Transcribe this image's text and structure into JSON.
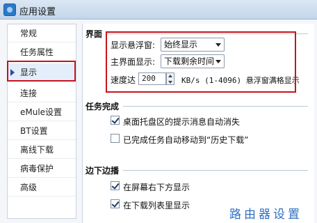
{
  "window": {
    "title": "应用设置"
  },
  "sidebar": {
    "items": [
      {
        "label": "常规"
      },
      {
        "label": "任务属性"
      },
      {
        "label": "显示"
      },
      {
        "label": "连接"
      },
      {
        "label": "eMule设置"
      },
      {
        "label": "BT设置"
      },
      {
        "label": "离线下载"
      },
      {
        "label": "病毒保护"
      },
      {
        "label": "高级"
      }
    ],
    "selected_index": 2
  },
  "sections": {
    "interface": {
      "title": "界面",
      "float_window_label": "显示悬浮窗:",
      "float_window_value": "始终显示",
      "main_display_label": "主界面显示:",
      "main_display_value": "下载剩余时间",
      "speed_prefix": "速度达",
      "speed_value": "200",
      "speed_suffix": "KB/s (1-4096) 悬浮窗满格显示"
    },
    "task_complete": {
      "title": "任务完成",
      "options": [
        {
          "label": "桌面托盘区的提示消息自动消失",
          "checked": true
        },
        {
          "label": "已完成任务自动移动到“历史下载”",
          "checked": false
        }
      ]
    },
    "edge_bar": {
      "title": "边下边播",
      "options": [
        {
          "label": "在屏幕右下方显示",
          "checked": true
        },
        {
          "label": "在下载列表里显示",
          "checked": true
        }
      ]
    }
  },
  "watermark": "路由器设置",
  "colors": {
    "highlight_border": "#c4151c",
    "watermark": "#2f6fc2",
    "selected_bg": "#e3eefa"
  }
}
